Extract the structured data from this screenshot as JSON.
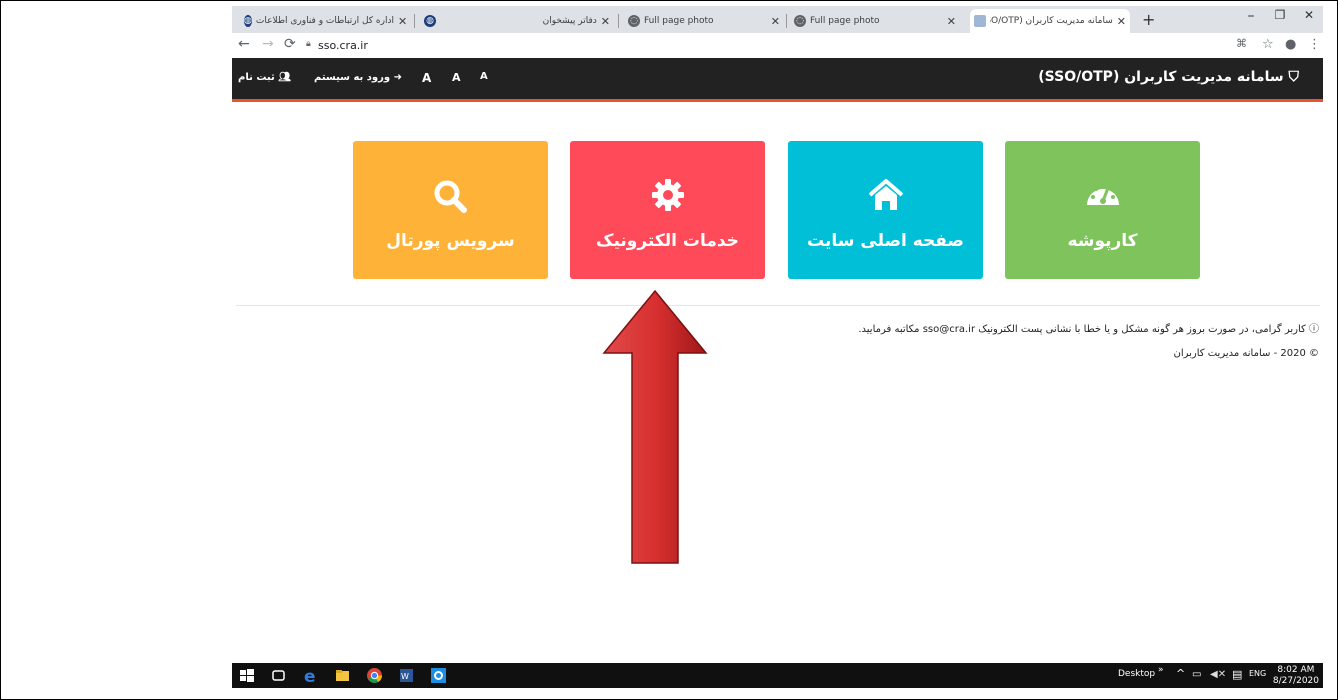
{
  "browser": {
    "tabs": [
      {
        "title": "اداره کل ارتباطات و فناوری اطلاعات",
        "active": false
      },
      {
        "title": "دفاتر پیشخوان",
        "active": false
      },
      {
        "title": "Full page photo",
        "active": false
      },
      {
        "title": "Full page photo",
        "active": false
      },
      {
        "title": "سامانه مدیریت کاربران (SSO/OTP)",
        "active": true
      }
    ],
    "new_tab": "+",
    "window_controls": {
      "minimize": "–",
      "maximize": "❐",
      "close": "✕"
    },
    "url": "sso.cra.ir"
  },
  "site": {
    "title": "سامانه مدیریت کاربران (SSO/OTP)",
    "register": "ثبت نام",
    "login": "ورود به سیستم",
    "font_sizes": [
      "A",
      "A",
      "A"
    ]
  },
  "tiles": [
    {
      "label": "سرویس پورتال",
      "icon": "search-icon",
      "color": "#ffb238"
    },
    {
      "label": "خدمات الکترونیک",
      "icon": "gear-icon",
      "color": "#ff4a5a"
    },
    {
      "label": "صفحه اصلی سایت",
      "icon": "home-icon",
      "color": "#00bfd6"
    },
    {
      "label": "کارپوشه",
      "icon": "dashboard-icon",
      "color": "#7ec35c"
    }
  ],
  "footer": {
    "note": "کاربر گرامی، در صورت بروز هر گونه مشکل و یا خطا با نشانی پست الکترونیک sso@cra.ir مکاتبه فرمایید.",
    "copyright": "© 2020 - سامانه مدیریت کاربران"
  },
  "taskbar": {
    "desktop_label": "Desktop",
    "language": "ENG",
    "time": "8:02 AM",
    "date": "8/27/2020"
  }
}
